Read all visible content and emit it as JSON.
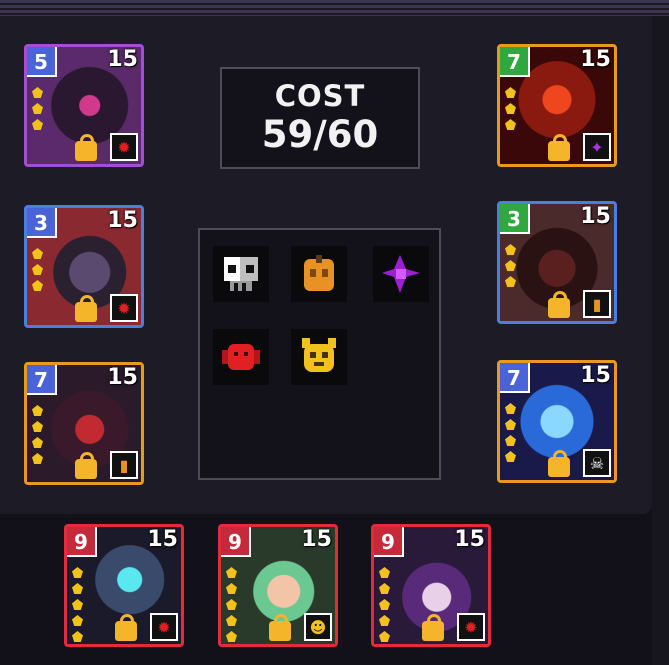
{
  "cost": {
    "label": "COST",
    "value": "59/60"
  },
  "traits": [
    {
      "name": "skull-trait-icon",
      "color": "#bfbfbf",
      "glyph": "☠"
    },
    {
      "name": "pumpkin-trait-icon",
      "color": "#f2a01e",
      "glyph": "▮"
    },
    {
      "name": "void-trait-icon",
      "color": "#9c1fd6",
      "glyph": "✦"
    },
    {
      "name": "demon-trait-icon",
      "color": "#e21f22",
      "glyph": "✹"
    },
    {
      "name": "beast-trait-icon",
      "color": "#f2c21c",
      "glyph": "☻"
    }
  ],
  "cards": [
    {
      "id": "purple-ghost-hood",
      "cost": "5",
      "hp": "15",
      "rarity": "purple",
      "badge": "#4a63d9",
      "trait": "demon",
      "art": "#3a1a4a"
    },
    {
      "id": "fire-demon",
      "cost": "7",
      "hp": "15",
      "rarity": "orange",
      "badge": "#2ea83f",
      "trait": "void",
      "art": "#7a1a10"
    },
    {
      "id": "jester-bat",
      "cost": "3",
      "hp": "15",
      "rarity": "blue",
      "badge": "#4a63d9",
      "trait": "demon",
      "art": "#3a2540"
    },
    {
      "id": "lava-golem",
      "cost": "3",
      "hp": "15",
      "rarity": "blue",
      "badge": "#2ea83f",
      "trait": "pumpkin",
      "art": "#2a1515"
    },
    {
      "id": "red-dragon",
      "cost": "7",
      "hp": "15",
      "rarity": "orange",
      "badge": "#4a63d9",
      "trait": "pumpkin",
      "art": "#3a1520"
    },
    {
      "id": "blue-flame-spirit",
      "cost": "7",
      "hp": "15",
      "rarity": "orange",
      "badge": "#4a63d9",
      "trait": "skull",
      "art": "#1a2f6a"
    },
    {
      "id": "crystal-knight",
      "cost": "9",
      "hp": "15",
      "rarity": "red",
      "badge": "#c62a3a",
      "trait": "demon",
      "art": "#1a2a3a"
    },
    {
      "id": "green-hair-girl",
      "cost": "9",
      "hp": "15",
      "rarity": "red",
      "badge": "#c62a3a",
      "trait": "beast",
      "art": "#2a3a2a"
    },
    {
      "id": "witch-cat",
      "cost": "9",
      "hp": "15",
      "rarity": "red",
      "badge": "#c62a3a",
      "trait": "demon",
      "art": "#2a1a3a"
    }
  ]
}
